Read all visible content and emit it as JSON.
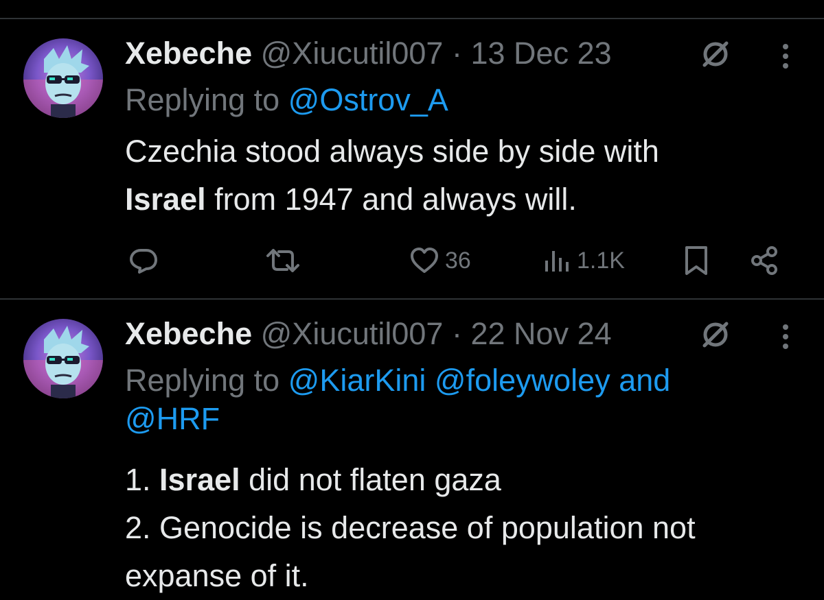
{
  "tweets": [
    {
      "name": "Xebeche",
      "handle": "@Xiucutil007",
      "separator": "·",
      "date": "13 Dec 23",
      "replying_prefix": "Replying to ",
      "mentions": [
        "@Ostrov_A"
      ],
      "body": {
        "line1": "Czechia stood always side by side with",
        "line2_bold": "Israel",
        "line2_rest": " from 1947 and always will."
      },
      "actions": {
        "reply_icon": "reply-icon",
        "retweet_icon": "retweet-icon",
        "like_icon": "heart-icon",
        "likes": "36",
        "views_icon": "views-icon",
        "views": "1.1K",
        "bookmark_icon": "bookmark-icon",
        "share_icon": "share-icon"
      }
    },
    {
      "name": "Xebeche",
      "handle": "@Xiucutil007",
      "separator": "·",
      "date": "22 Nov 24",
      "replying_prefix": "Replying to ",
      "mentions": [
        "@KiarKini",
        "@foleywoley",
        "@HRF"
      ],
      "mention_joiner": " and",
      "body": {
        "line1_prefix": "1. ",
        "line1_bold": "Israel",
        "line1_rest": " did not flaten gaza",
        "line2": "2. Genocide is decrease of population not",
        "line3": "expanse of it."
      }
    }
  ],
  "colors": {
    "background": "#000000",
    "text": "#e7e9ea",
    "muted": "#71767b",
    "accent": "#1d9bf0",
    "divider": "#2f3336"
  }
}
